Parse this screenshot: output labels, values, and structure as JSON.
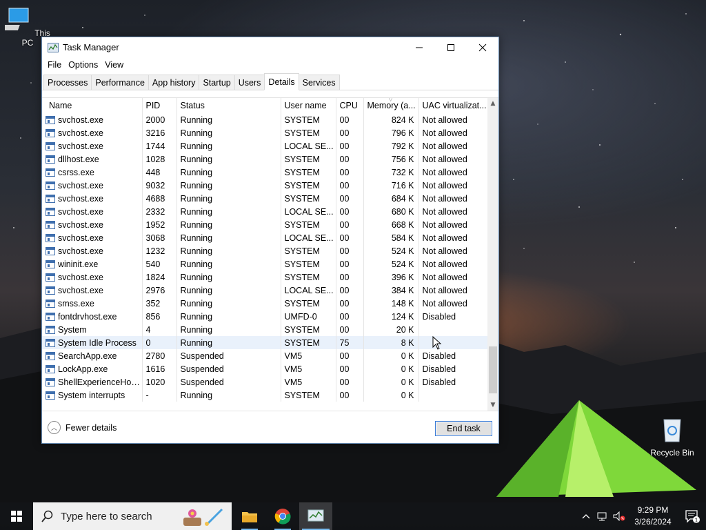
{
  "desktop": {
    "icons": [
      {
        "label": "This PC"
      },
      {
        "label": "Recycle Bin"
      }
    ]
  },
  "window": {
    "title": "Task Manager",
    "controls": {
      "minimize": "—",
      "maximize": "☐",
      "close": "✕"
    }
  },
  "menu": [
    "File",
    "Options",
    "View"
  ],
  "tabs": [
    "Processes",
    "Performance",
    "App history",
    "Startup",
    "Users",
    "Details",
    "Services"
  ],
  "active_tab": "Details",
  "columns": [
    "Name",
    "PID",
    "Status",
    "User name",
    "CPU",
    "Memory (a...",
    "UAC virtualizat..."
  ],
  "rows": [
    {
      "name": "svchost.exe",
      "pid": "2000",
      "status": "Running",
      "user": "SYSTEM",
      "cpu": "00",
      "mem": "824 K",
      "uac": "Not allowed"
    },
    {
      "name": "svchost.exe",
      "pid": "3216",
      "status": "Running",
      "user": "SYSTEM",
      "cpu": "00",
      "mem": "796 K",
      "uac": "Not allowed"
    },
    {
      "name": "svchost.exe",
      "pid": "1744",
      "status": "Running",
      "user": "LOCAL SE...",
      "cpu": "00",
      "mem": "792 K",
      "uac": "Not allowed"
    },
    {
      "name": "dllhost.exe",
      "pid": "1028",
      "status": "Running",
      "user": "SYSTEM",
      "cpu": "00",
      "mem": "756 K",
      "uac": "Not allowed"
    },
    {
      "name": "csrss.exe",
      "pid": "448",
      "status": "Running",
      "user": "SYSTEM",
      "cpu": "00",
      "mem": "732 K",
      "uac": "Not allowed"
    },
    {
      "name": "svchost.exe",
      "pid": "9032",
      "status": "Running",
      "user": "SYSTEM",
      "cpu": "00",
      "mem": "716 K",
      "uac": "Not allowed"
    },
    {
      "name": "svchost.exe",
      "pid": "4688",
      "status": "Running",
      "user": "SYSTEM",
      "cpu": "00",
      "mem": "684 K",
      "uac": "Not allowed"
    },
    {
      "name": "svchost.exe",
      "pid": "2332",
      "status": "Running",
      "user": "LOCAL SE...",
      "cpu": "00",
      "mem": "680 K",
      "uac": "Not allowed"
    },
    {
      "name": "svchost.exe",
      "pid": "1952",
      "status": "Running",
      "user": "SYSTEM",
      "cpu": "00",
      "mem": "668 K",
      "uac": "Not allowed"
    },
    {
      "name": "svchost.exe",
      "pid": "3068",
      "status": "Running",
      "user": "LOCAL SE...",
      "cpu": "00",
      "mem": "584 K",
      "uac": "Not allowed"
    },
    {
      "name": "svchost.exe",
      "pid": "1232",
      "status": "Running",
      "user": "SYSTEM",
      "cpu": "00",
      "mem": "524 K",
      "uac": "Not allowed"
    },
    {
      "name": "wininit.exe",
      "pid": "540",
      "status": "Running",
      "user": "SYSTEM",
      "cpu": "00",
      "mem": "524 K",
      "uac": "Not allowed"
    },
    {
      "name": "svchost.exe",
      "pid": "1824",
      "status": "Running",
      "user": "SYSTEM",
      "cpu": "00",
      "mem": "396 K",
      "uac": "Not allowed"
    },
    {
      "name": "svchost.exe",
      "pid": "2976",
      "status": "Running",
      "user": "LOCAL SE...",
      "cpu": "00",
      "mem": "384 K",
      "uac": "Not allowed"
    },
    {
      "name": "smss.exe",
      "pid": "352",
      "status": "Running",
      "user": "SYSTEM",
      "cpu": "00",
      "mem": "148 K",
      "uac": "Not allowed"
    },
    {
      "name": "fontdrvhost.exe",
      "pid": "856",
      "status": "Running",
      "user": "UMFD-0",
      "cpu": "00",
      "mem": "124 K",
      "uac": "Disabled"
    },
    {
      "name": "System",
      "pid": "4",
      "status": "Running",
      "user": "SYSTEM",
      "cpu": "00",
      "mem": "20 K",
      "uac": ""
    },
    {
      "name": "System Idle Process",
      "pid": "0",
      "status": "Running",
      "user": "SYSTEM",
      "cpu": "75",
      "mem": "8 K",
      "uac": "",
      "selected": true
    },
    {
      "name": "SearchApp.exe",
      "pid": "2780",
      "status": "Suspended",
      "user": "VM5",
      "cpu": "00",
      "mem": "0 K",
      "uac": "Disabled"
    },
    {
      "name": "LockApp.exe",
      "pid": "1616",
      "status": "Suspended",
      "user": "VM5",
      "cpu": "00",
      "mem": "0 K",
      "uac": "Disabled"
    },
    {
      "name": "ShellExperienceHost....",
      "pid": "1020",
      "status": "Suspended",
      "user": "VM5",
      "cpu": "00",
      "mem": "0 K",
      "uac": "Disabled"
    },
    {
      "name": "System interrupts",
      "pid": "-",
      "status": "Running",
      "user": "SYSTEM",
      "cpu": "00",
      "mem": "0 K",
      "uac": ""
    }
  ],
  "footer": {
    "fewer_details": "Fewer details",
    "end_task": "End task"
  },
  "taskbar": {
    "search_placeholder": "Type here to search",
    "apps": [
      "file-explorer",
      "chrome",
      "task-manager"
    ],
    "time": "9:29 PM",
    "date": "3/26/2024",
    "notification_count": "1"
  },
  "colors": {
    "accent": "#76b9ed",
    "selected_row": "#e9f1fb",
    "button_border": "#3a7bd5"
  }
}
